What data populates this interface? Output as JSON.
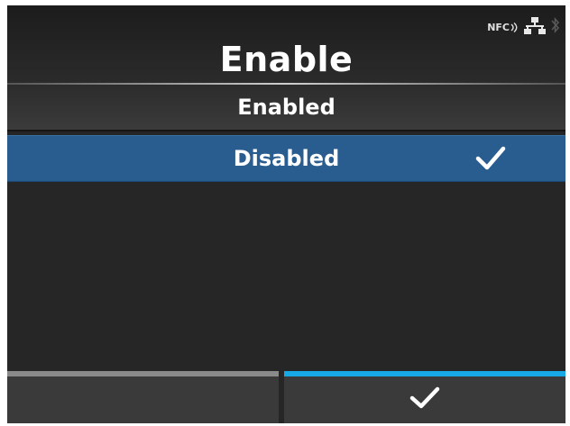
{
  "header": {
    "title": "Enable",
    "status": {
      "nfc_label": "NFC",
      "icons": [
        "nfc-icon",
        "network-icon",
        "bluetooth-icon"
      ]
    }
  },
  "options": [
    {
      "label": "Enabled",
      "selected": false
    },
    {
      "label": "Disabled",
      "selected": true
    }
  ],
  "footer": {
    "left_button": "",
    "right_button_icon": "check-icon"
  },
  "colors": {
    "background": "#262626",
    "selected_row": "#2a5d8f",
    "confirm_accent": "#17a9e6",
    "inactive_accent": "#8a8a8a"
  }
}
